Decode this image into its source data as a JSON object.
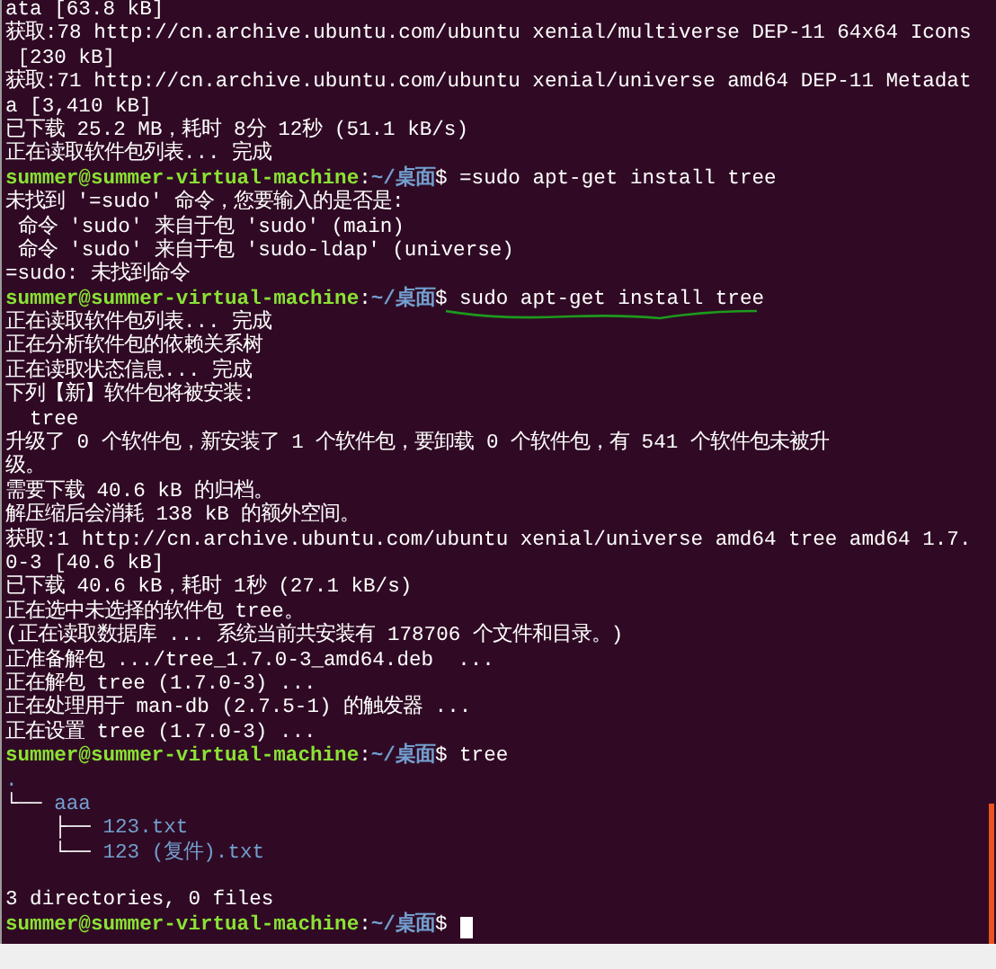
{
  "lines": [
    {
      "kind": "text",
      "text": "ata [63.8 kB]"
    },
    {
      "kind": "text",
      "text": "获取:78 http://cn.archive.ubuntu.com/ubuntu xenial/multiverse DEP-11 64x64 Icons"
    },
    {
      "kind": "text",
      "text": " [230 kB]"
    },
    {
      "kind": "text",
      "text": "获取:71 http://cn.archive.ubuntu.com/ubuntu xenial/universe amd64 DEP-11 Metadat"
    },
    {
      "kind": "text",
      "text": "a [3,410 kB]"
    },
    {
      "kind": "text",
      "text": "已下载 25.2 MB，耗时 8分 12秒 (51.1 kB/s)"
    },
    {
      "kind": "text",
      "text": "正在读取软件包列表... 完成"
    },
    {
      "kind": "prompt",
      "user_host": "summer@summer-virtual-machine",
      "separator": ":",
      "path": "~/桌面",
      "symbol": "$",
      "command": "=sudo apt-get install tree",
      "underlined": false,
      "cursor": false
    },
    {
      "kind": "text",
      "text": "未找到 '=sudo' 命令，您要输入的是否是:"
    },
    {
      "kind": "text",
      "text": " 命令 'sudo' 来自于包 'sudo' (main)"
    },
    {
      "kind": "text",
      "text": " 命令 'sudo' 来自于包 'sudo-ldap' (universe)"
    },
    {
      "kind": "text",
      "text": "=sudo: 未找到命令"
    },
    {
      "kind": "prompt",
      "user_host": "summer@summer-virtual-machine",
      "separator": ":",
      "path": "~/桌面",
      "symbol": "$",
      "command": "sudo apt-get install tree",
      "underlined": true,
      "cursor": false
    },
    {
      "kind": "text",
      "text": "正在读取软件包列表... 完成"
    },
    {
      "kind": "text",
      "text": "正在分析软件包的依赖关系树"
    },
    {
      "kind": "text",
      "text": "正在读取状态信息... 完成"
    },
    {
      "kind": "text",
      "text": "下列【新】软件包将被安装:"
    },
    {
      "kind": "text",
      "text": "  tree"
    },
    {
      "kind": "text",
      "text": "升级了 0 个软件包，新安装了 1 个软件包，要卸载 0 个软件包，有 541 个软件包未被升"
    },
    {
      "kind": "text",
      "text": "级。"
    },
    {
      "kind": "text",
      "text": "需要下载 40.6 kB 的归档。"
    },
    {
      "kind": "text",
      "text": "解压缩后会消耗 138 kB 的额外空间。"
    },
    {
      "kind": "text",
      "text": "获取:1 http://cn.archive.ubuntu.com/ubuntu xenial/universe amd64 tree amd64 1.7."
    },
    {
      "kind": "text",
      "text": "0-3 [40.6 kB]"
    },
    {
      "kind": "text",
      "text": "已下载 40.6 kB，耗时 1秒 (27.1 kB/s)"
    },
    {
      "kind": "text",
      "text": "正在选中未选择的软件包 tree。"
    },
    {
      "kind": "text",
      "text": "(正在读取数据库 ... 系统当前共安装有 178706 个文件和目录。)"
    },
    {
      "kind": "text",
      "text": "正准备解包 .../tree_1.7.0-3_amd64.deb  ..."
    },
    {
      "kind": "text",
      "text": "正在解包 tree (1.7.0-3) ..."
    },
    {
      "kind": "text",
      "text": "正在处理用于 man-db (2.7.5-1) 的触发器 ..."
    },
    {
      "kind": "text",
      "text": "正在设置 tree (1.7.0-3) ..."
    },
    {
      "kind": "prompt",
      "user_host": "summer@summer-virtual-machine",
      "separator": ":",
      "path": "~/桌面",
      "symbol": "$",
      "command": "tree",
      "underlined": false,
      "cursor": false
    },
    {
      "kind": "tree",
      "name": "."
    },
    {
      "kind": "tree",
      "branch": "└── ",
      "name": "aaa"
    },
    {
      "kind": "tree",
      "branch": "    ├── ",
      "name": "123.txt"
    },
    {
      "kind": "tree",
      "branch": "    └── ",
      "name": "123 (复件).txt"
    },
    {
      "kind": "blank"
    },
    {
      "kind": "text",
      "text": "3 directories, 0 files"
    },
    {
      "kind": "prompt",
      "user_host": "summer@summer-virtual-machine",
      "separator": ":",
      "path": "~/桌面",
      "symbol": "$",
      "underlined": false,
      "cursor": true
    }
  ]
}
